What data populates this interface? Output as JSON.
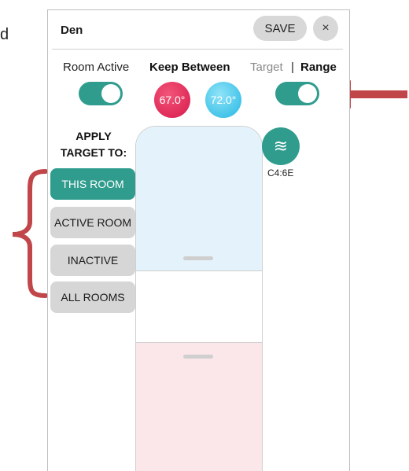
{
  "fragment": {
    "text": "d"
  },
  "header": {
    "room_name": "Den",
    "save_label": "SAVE",
    "close_label": "×"
  },
  "controls": {
    "room_active_label": "Room Active",
    "room_active_on": true,
    "keep_between_label": "Keep Between",
    "low_setpoint": "67.0°",
    "high_setpoint": "72.0°",
    "mode_target_label": "Target",
    "mode_separator": "|",
    "mode_range_label": "Range",
    "range_mode_on": true
  },
  "apply": {
    "heading_line1": "APPLY",
    "heading_line2": "TARGET TO:",
    "options": [
      {
        "label": "THIS ROOM",
        "selected": true
      },
      {
        "label": "ACTIVE ROOM",
        "selected": false
      },
      {
        "label": "INACTIVE",
        "selected": false
      },
      {
        "label": "ALL ROOMS",
        "selected": false
      }
    ]
  },
  "fan": {
    "icon": "fan-mode-icon",
    "glyph": "≋",
    "device_code": "C4:6E"
  },
  "colors": {
    "accent": "#2f9c8e",
    "heat": "#d8194a",
    "cool": "#25b7e3",
    "annotation": "#c0464a"
  }
}
